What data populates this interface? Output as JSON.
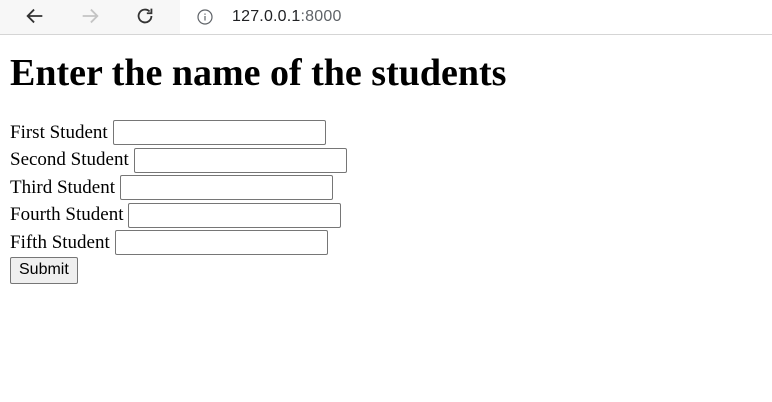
{
  "browser": {
    "url_host": "127.0.0.1",
    "url_port": ":8000"
  },
  "page": {
    "heading": "Enter the name of the students",
    "fields": [
      {
        "label": "First Student",
        "value": ""
      },
      {
        "label": "Second Student",
        "value": ""
      },
      {
        "label": "Third Student",
        "value": ""
      },
      {
        "label": "Fourth Student",
        "value": ""
      },
      {
        "label": "Fifth Student",
        "value": ""
      }
    ],
    "submit_label": "Submit"
  }
}
